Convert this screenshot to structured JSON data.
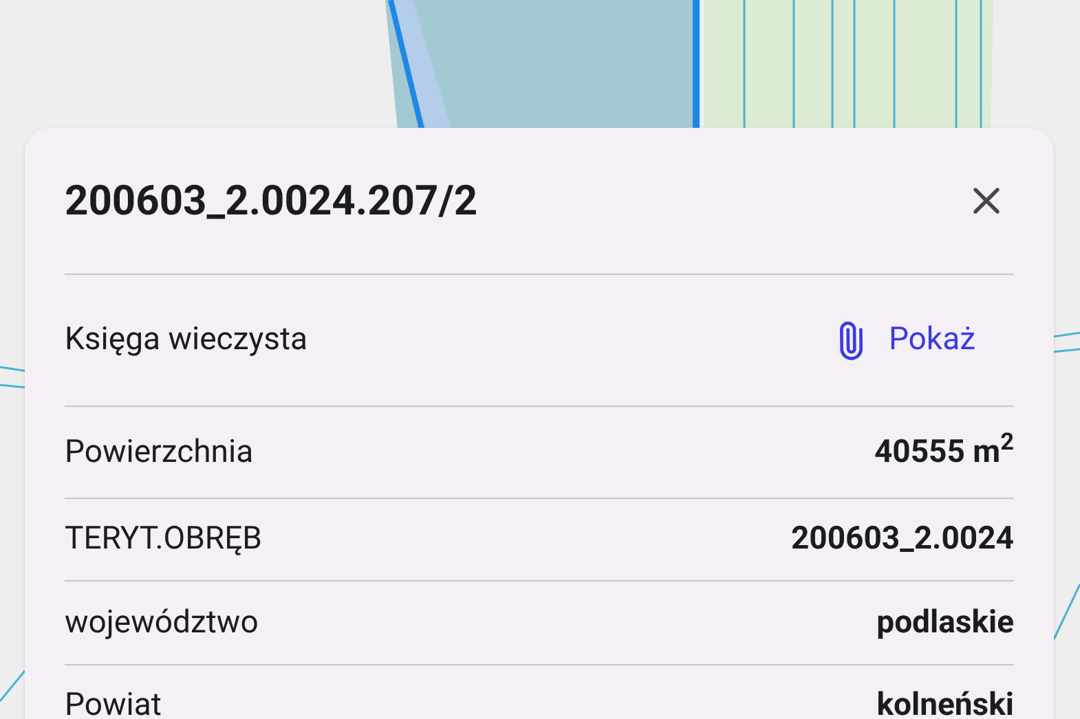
{
  "parcel": {
    "title": "200603_2.0024.207/2",
    "rows": [
      {
        "kind": "link",
        "label": "Księga wieczysta",
        "value": "Pokaż"
      },
      {
        "kind": "value",
        "label": "Powierzchnia",
        "value": "40555 m$^{2}$"
      },
      {
        "kind": "value",
        "label": "TERYT.OBRĘB",
        "value": "200603_2.0024"
      },
      {
        "kind": "value",
        "label": "województwo",
        "value": "podlaskie"
      },
      {
        "kind": "value",
        "label": "Powiat",
        "value": "kolneński"
      }
    ]
  }
}
